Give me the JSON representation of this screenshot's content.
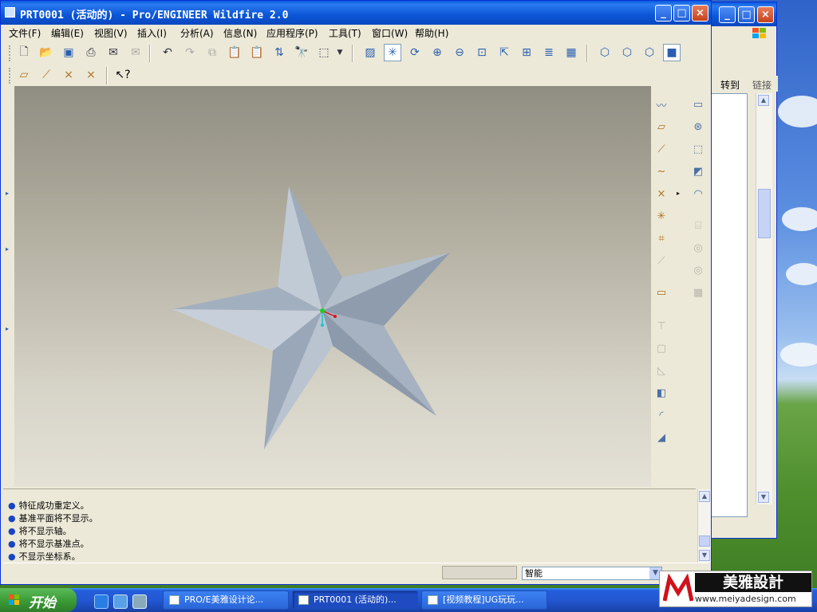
{
  "window": {
    "title": "PRT0001 (活动的) - Pro/ENGINEER Wildfire 2.0"
  },
  "menubar": {
    "items": [
      "文件(F)",
      "编辑(E)",
      "视图(V)",
      "插入(I)",
      "分析(A)",
      "信息(N)",
      "应用程序(P)",
      "工具(T)",
      "窗口(W)",
      "帮助(H)"
    ]
  },
  "messages": [
    "特征成功重定义。",
    "基准平面将不显示。",
    "将不显示轴。",
    "将不显示基准点。",
    "不显示坐标系。"
  ],
  "status": {
    "filter_value": "智能"
  },
  "second_window": {
    "goto_label": "转到",
    "link_label": "链接"
  },
  "taskbar": {
    "start_label": "开始",
    "tasks": [
      "PRO/E美雅设计论...",
      "PRT0001 (活动的)...",
      "[视频教程]UG玩玩..."
    ]
  },
  "watermark": {
    "brand": "美雅設計",
    "url": "www.meiyadesign.com"
  },
  "colors": {
    "title_blue": "#0a5bdb",
    "star_fill": "#a9b5c3",
    "bullet": "#1a44c2"
  }
}
